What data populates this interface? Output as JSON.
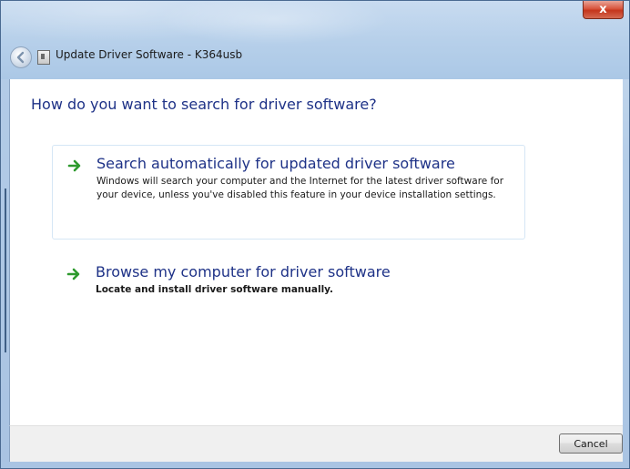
{
  "window": {
    "title": "Update Driver Software - K364usb",
    "close_label": "x"
  },
  "main": {
    "heading": "How do you want to search for driver software?",
    "options": [
      {
        "title": "Search automatically for updated driver software",
        "description": "Windows will search your computer and the Internet for the latest driver software for your device, unless you've disabled this feature in your device installation settings."
      },
      {
        "title": "Browse my computer for driver software",
        "description": "Locate and install driver software manually."
      }
    ]
  },
  "footer": {
    "cancel_label": "Cancel"
  },
  "icons": {
    "back": "back-arrow-icon",
    "option_arrow": "green-arrow-icon",
    "app": "device-icon"
  },
  "colors": {
    "heading": "#1e3287",
    "arrow": "#2e9a2e",
    "close": "#c4351c"
  }
}
